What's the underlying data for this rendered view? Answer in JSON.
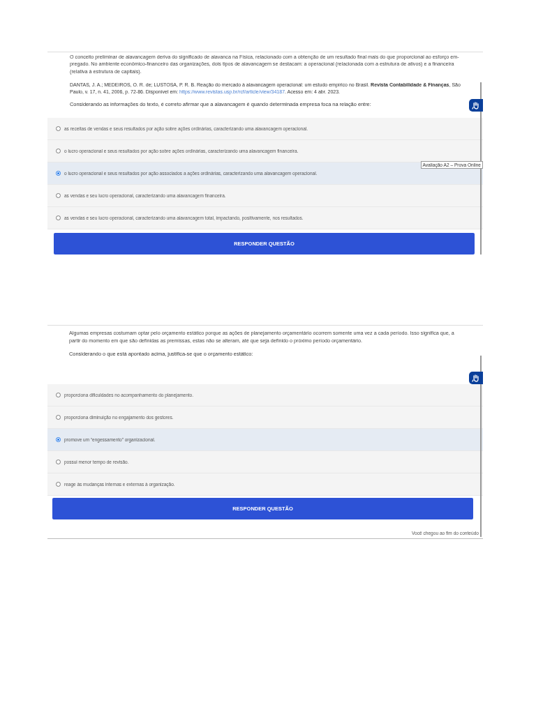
{
  "questions": [
    {
      "paragraphs": [
        "O conceito preliminar de alavancagem deriva do significado de alavanca na Física, relacionado com a obtenção de um resultado final mais do que proporcional ao esforço em-pregado. No ambiente econômico-financeiro das organizações, dois tipos de alavancagem se destacam: a operacional (relacionada com a estrutura de ativos) e a financeira (relativa à estrutura de capitais)."
      ],
      "citation": {
        "text": "DANTAS, J. A.; MEDEIROS, O. R. de; LUSTOSA, P. R. B. Reação do mercado à alavancagem operacional: um estudo empírico no Brasil. **Revista Contabilidade & Finanças**, São Paulo, v. 17, n. 41, 2006, p. 72-86. Disponível em:",
        "link": "https://www.revistas.usp.br/rcf/article/view/34187",
        "after": ". Acesso em: 4 abr. 2023."
      },
      "prompt": "Considerando as informações do texto, é correto afirmar que a alavancagem é quando determinada empresa foca na relação entre:",
      "options": [
        {
          "text": "as receitas de vendas e seus resultados por ação sobre ações ordinárias, caracterizando uma alavancagem operacional.",
          "selected": false
        },
        {
          "text": "o lucro operacional e seus resultados por ação sobre ações ordinárias, caracterizando uma alavancagem financeira.",
          "selected": false
        },
        {
          "text": "o lucro operacional e seus resultados por ação associados a ações ordinárias, caracterizando uma alavancagem operacional.",
          "selected": true
        },
        {
          "text": "as vendas e seu lucro operacional, caracterizando uma alavancagem financeira.",
          "selected": false
        },
        {
          "text": "as vendas e seu lucro operacional, caracterizando uma alavancagem total, impactando, positivamente, nos resultados.",
          "selected": false
        }
      ],
      "button": "RESPONDER QUESTÃO",
      "tooltip": "Avaliação A2 – Prova Online"
    },
    {
      "paragraphs": [
        "Algumas empresas costumam optar pelo orçamento estático porque as ações de planejamento orçamentário ocorrem somente uma vez a cada período. Isso significa que, a partir do momento em que são definidas as premissas, estas não se alteram, até que seja definido o próximo período orçamentário."
      ],
      "prompt": "Considerando o que está apontado acima, justifica-se que o orçamento estático:",
      "options": [
        {
          "text": "proporciona dificuldades no acompanhamento do planejamento.",
          "selected": false
        },
        {
          "text": "proporciona diminuição no engajamento dos gestores.",
          "selected": false
        },
        {
          "text": "promove um “engessamento” organizacional.",
          "selected": true
        },
        {
          "text": "possui menor tempo de revisão.",
          "selected": false
        },
        {
          "text": "reage às mudanças internas e externas à organização.",
          "selected": false
        }
      ],
      "button": "RESPONDER QUESTÃO",
      "end_note": "Você chegou ao fim do conteúdo"
    }
  ]
}
